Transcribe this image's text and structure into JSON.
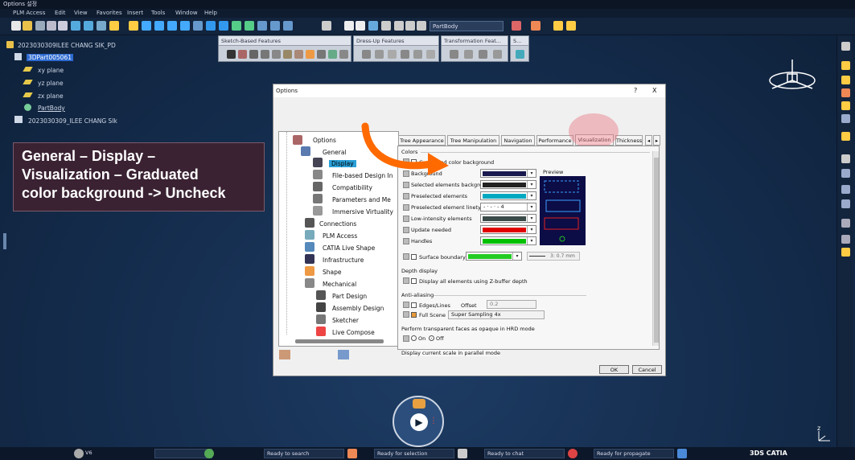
{
  "window": {
    "title": "Options 설정"
  },
  "menu": [
    "PLM Access",
    "Edit",
    "View",
    "Favorites",
    "Insert",
    "Tools",
    "Window",
    "Help"
  ],
  "toolbar": {
    "workbench_combo": "PartBody"
  },
  "floating_toolbars": [
    {
      "title": "Sketch-Based Features"
    },
    {
      "title": "Dress-Up Features"
    },
    {
      "title": "Transformation Feat..."
    },
    {
      "title": "S..."
    }
  ],
  "tree": {
    "root": "2023030309ILEE CHANG SIK_PD",
    "part": "3DPart005061",
    "children": [
      "xy plane",
      "yz plane",
      "zx plane",
      "PartBody"
    ],
    "product": "2023030309_ILEE CHANG SIk"
  },
  "annotation": {
    "line1": "General – Display –",
    "line2": "Visualization – Graduated",
    "line3": "color background -> Uncheck"
  },
  "dialog": {
    "title": "Options",
    "help": "?",
    "close": "X",
    "tree": [
      {
        "label": "Options"
      },
      {
        "label": "General"
      },
      {
        "label": "Display",
        "selected": true
      },
      {
        "label": "File-based Design In"
      },
      {
        "label": "Compatibility"
      },
      {
        "label": "Parameters and Me"
      },
      {
        "label": "Immersive Virtuality"
      },
      {
        "label": "Connections"
      },
      {
        "label": "PLM Access"
      },
      {
        "label": "CATIA Live Shape"
      },
      {
        "label": "Infrastructure"
      },
      {
        "label": "Shape"
      },
      {
        "label": "Mechanical"
      },
      {
        "label": "Part Design"
      },
      {
        "label": "Assembly Design"
      },
      {
        "label": "Sketcher"
      },
      {
        "label": "Live Compose"
      }
    ],
    "tabs": [
      "Tree Appearance",
      "Tree Manipulation",
      "Navigation",
      "Performance",
      "Visualization",
      "Thickness"
    ],
    "active_tab": "Visualization",
    "colors_section": "Colors",
    "graduated_label": "Graduated color background",
    "graduated_checked": false,
    "color_rows": [
      {
        "label": "Background",
        "color": "#1a1a50"
      },
      {
        "label": "Selected elements background",
        "color": "#222222"
      },
      {
        "label": "Preselected elements",
        "color": "#00a8c0"
      },
      {
        "label": "Preselected element linetype",
        "value": "- · - · -   4"
      },
      {
        "label": "Low-intensity elements",
        "color": "#3a4a48"
      },
      {
        "label": "Update needed",
        "color": "#e00000"
      },
      {
        "label": "Handles",
        "color": "#00c000"
      }
    ],
    "preview_label": "Preview",
    "surface_boundary": {
      "label": "Surface boundary",
      "color": "#22cc22",
      "thickness": "3: 0.7 mm"
    },
    "depth_section": "Depth display",
    "depth_option": "Display all elements using Z-buffer depth",
    "anti_section": "Anti-aliasing",
    "edges_label": "Edges/Lines",
    "offset_label": "Offset",
    "offset_value": "0.2",
    "fullscene_label": "Full Scene",
    "fullscene_value": "Super Sampling 4x",
    "transparent_section": "Perform transparent faces as opaque in HRD mode",
    "on_label": "On",
    "off_label": "Off",
    "parallel_section": "Display current scale in parallel mode",
    "ok": "OK",
    "cancel": "Cancel"
  },
  "status": [
    "Ready to search",
    "Ready for selection",
    "Ready to chat",
    "Ready for propagate"
  ],
  "status_left": "V6",
  "brand": "3DS CATIA",
  "compass_axis": "z"
}
